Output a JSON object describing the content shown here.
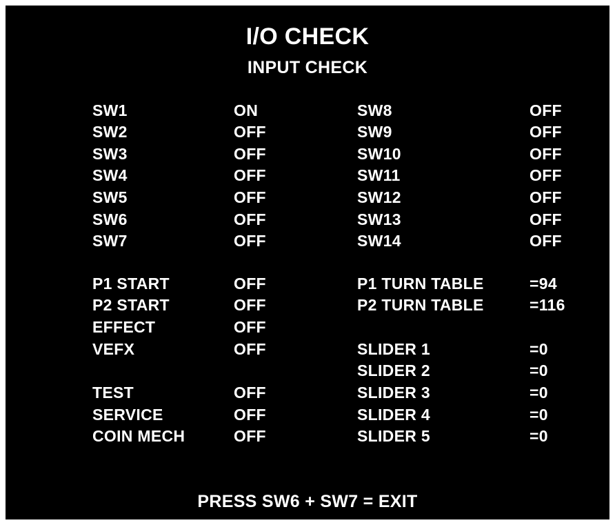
{
  "header": {
    "title": "I/O CHECK",
    "subtitle": "INPUT CHECK"
  },
  "switches_left": [
    {
      "label": "SW1",
      "value": "ON"
    },
    {
      "label": "SW2",
      "value": "OFF"
    },
    {
      "label": "SW3",
      "value": "OFF"
    },
    {
      "label": "SW4",
      "value": "OFF"
    },
    {
      "label": "SW5",
      "value": "OFF"
    },
    {
      "label": "SW6",
      "value": "OFF"
    },
    {
      "label": "SW7",
      "value": "OFF"
    }
  ],
  "switches_right": [
    {
      "label": "SW8",
      "value": "OFF"
    },
    {
      "label": "SW9",
      "value": "OFF"
    },
    {
      "label": "SW10",
      "value": "OFF"
    },
    {
      "label": "SW11",
      "value": "OFF"
    },
    {
      "label": "SW12",
      "value": "OFF"
    },
    {
      "label": "SW13",
      "value": "OFF"
    },
    {
      "label": "SW14",
      "value": "OFF"
    }
  ],
  "buttons": [
    {
      "label": "P1 START",
      "value": "OFF"
    },
    {
      "label": "P2 START",
      "value": "OFF"
    },
    {
      "label": "EFFECT",
      "value": "OFF"
    },
    {
      "label": "VEFX",
      "value": "OFF"
    }
  ],
  "system": [
    {
      "label": "TEST",
      "value": "OFF"
    },
    {
      "label": "SERVICE",
      "value": "OFF"
    },
    {
      "label": "COIN MECH",
      "value": "OFF"
    }
  ],
  "turntables": [
    {
      "label": "P1 TURN TABLE",
      "value": "=94"
    },
    {
      "label": "P2 TURN TABLE",
      "value": "=116"
    }
  ],
  "sliders": [
    {
      "label": "SLIDER 1",
      "value": "=0"
    },
    {
      "label": "SLIDER 2",
      "value": "=0"
    },
    {
      "label": "SLIDER 3",
      "value": "=0"
    },
    {
      "label": "SLIDER 4",
      "value": "=0"
    },
    {
      "label": "SLIDER 5",
      "value": "=0"
    }
  ],
  "footer": {
    "instruction": "PRESS SW6 + SW7 = EXIT"
  },
  "colors": {
    "background": "#000000",
    "text": "#ffffff",
    "frame": "#ffffff"
  }
}
